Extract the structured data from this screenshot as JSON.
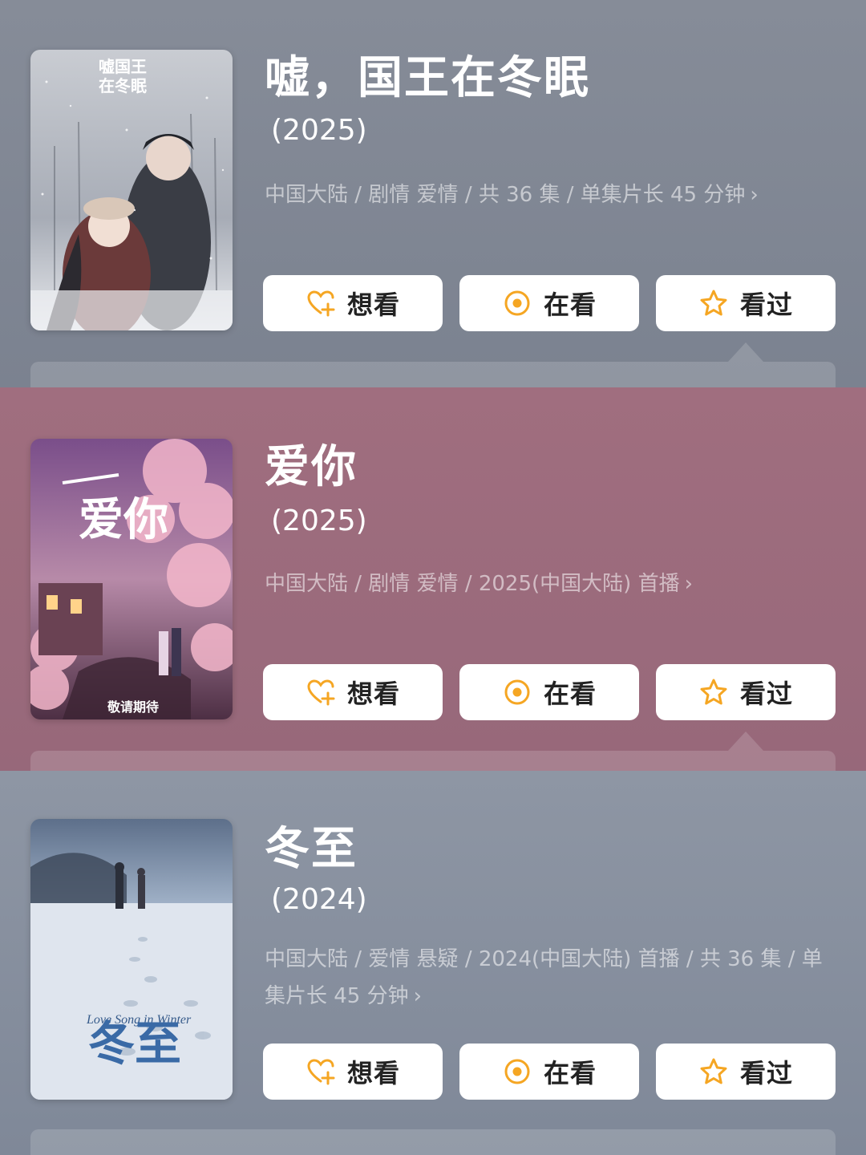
{
  "items": [
    {
      "title": "嘘，国王在冬眠",
      "year": "(2025)",
      "meta": "中国大陆 / 剧情 爱情 / 共 36 集 / 单集片长 45 分钟",
      "poster_title": "嘘国王在冬眠",
      "buttons": [
        {
          "label": "想看",
          "icon": "heart-plus-icon"
        },
        {
          "label": "在看",
          "icon": "target-circle-icon"
        },
        {
          "label": "看过",
          "icon": "star-icon"
        }
      ]
    },
    {
      "title": "爱你",
      "year": "(2025)",
      "meta": "中国大陆 / 剧情 爱情 / 2025(中国大陆) 首播",
      "poster_title": "一爱你",
      "poster_caption": "敬请期待",
      "buttons": [
        {
          "label": "想看",
          "icon": "heart-plus-icon"
        },
        {
          "label": "在看",
          "icon": "target-circle-icon"
        },
        {
          "label": "看过",
          "icon": "star-icon"
        }
      ]
    },
    {
      "title": "冬至",
      "year": "(2024)",
      "meta": "中国大陆 / 爱情 悬疑 / 2024(中国大陆) 首播 / 共 36 集 / 单集片长 45 分钟",
      "poster_title": "冬至",
      "poster_subtitle": "Love Song in Winter",
      "buttons": [
        {
          "label": "想看",
          "icon": "heart-plus-icon"
        },
        {
          "label": "在看",
          "icon": "target-circle-icon"
        },
        {
          "label": "看过",
          "icon": "star-icon"
        }
      ]
    }
  ],
  "colors": {
    "icon_accent": "#f5a623",
    "card_1_bg": "#7f8694",
    "card_2_bg": "#9a6a7c",
    "card_3_bg": "#858e9e"
  }
}
